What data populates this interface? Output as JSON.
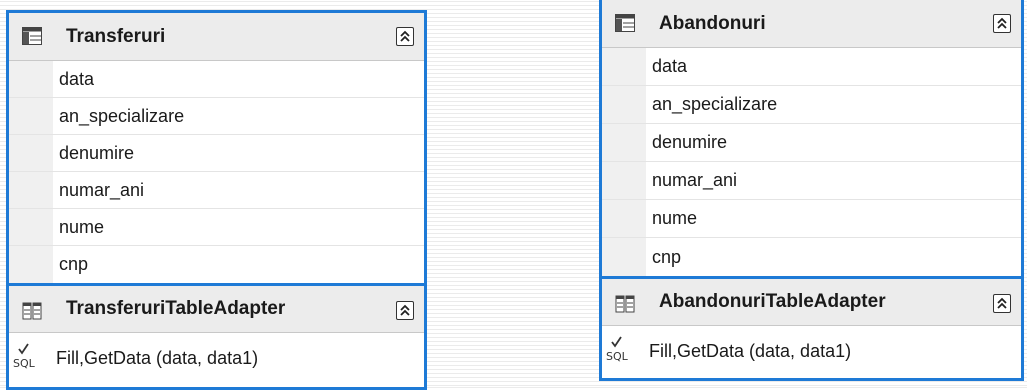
{
  "tables": [
    {
      "title": "Transferuri",
      "columns": [
        "data",
        "an_specializare",
        "denumire",
        "numar_ani",
        "nume",
        "cnp"
      ],
      "adapter": {
        "title": "TransferuriTableAdapter",
        "query": "Fill,GetData (data, data1)"
      }
    },
    {
      "title": "Abandonuri",
      "columns": [
        "data",
        "an_specializare",
        "denumire",
        "numar_ani",
        "nume",
        "cnp"
      ],
      "adapter": {
        "title": "AbandonuriTableAdapter",
        "query": "Fill,GetData (data, data1)"
      }
    }
  ],
  "icons": {
    "table": "table-icon",
    "adapter": "table-adapter-icon",
    "query": "sql-query-icon",
    "collapse": "collapse-chevron-icon"
  },
  "colors": {
    "selection_border": "#1e7ad6",
    "header_bg": "#ececec",
    "gutter_bg": "#f0f0f0"
  }
}
